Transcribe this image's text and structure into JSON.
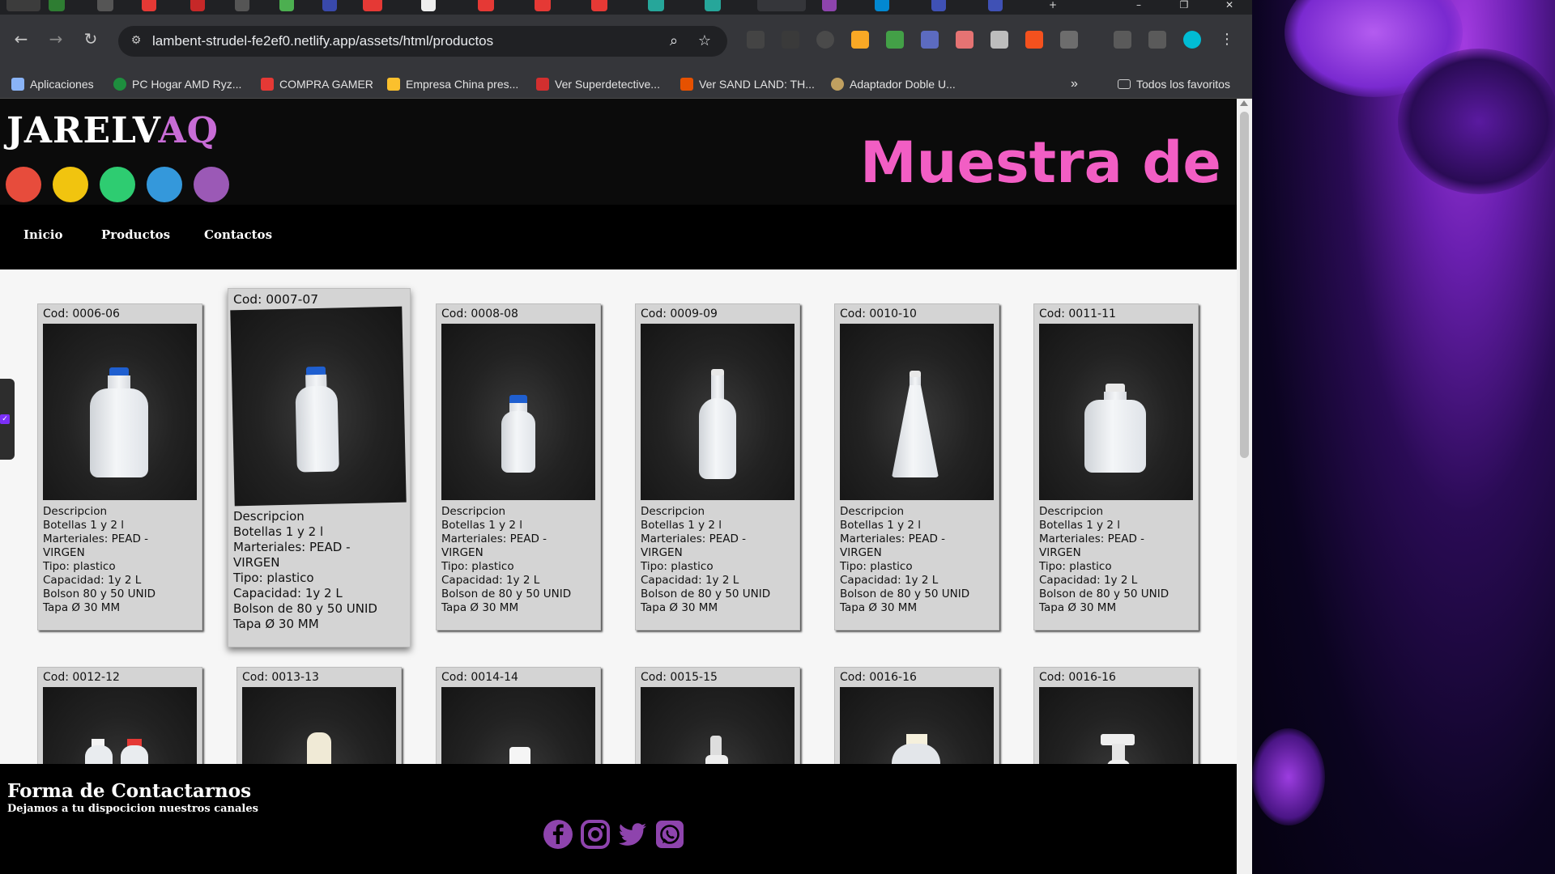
{
  "browser": {
    "url": "lambent-strudel-fe2ef0.netlify.app/assets/html/productos",
    "bookmarks": [
      {
        "label": "Aplicaciones",
        "color": "#8ab4f8"
      },
      {
        "label": "PC Hogar AMD Ryz...",
        "color": "#1e8e3e"
      },
      {
        "label": "COMPRA GAMER",
        "color": "#e53935"
      },
      {
        "label": "Empresa China pres...",
        "color": "#fbc02d"
      },
      {
        "label": "Ver Superdetective...",
        "color": "#d32f2f"
      },
      {
        "label": "Ver SAND LAND: TH...",
        "color": "#e65100"
      },
      {
        "label": "Adaptador Doble U...",
        "color": "#c0a060"
      }
    ],
    "all_bookmarks": "Todos los favoritos"
  },
  "site": {
    "logo_part1": "JARELV",
    "logo_part2": "AQ",
    "title": "Muestra de Productos",
    "dot_colors": [
      "#e74c3c",
      "#f1c40f",
      "#2ecc71",
      "#3498db",
      "#9b59b6"
    ],
    "nav": [
      "Inicio",
      "Productos",
      "Contactos"
    ]
  },
  "products": [
    {
      "code": "Cod: 0006-06",
      "desc": [
        "Descripcion",
        "Botellas 1 y 2 l",
        "Marteriales: PEAD -",
        "VIRGEN",
        "Tipo: plastico",
        "Capacidad: 1y 2 L",
        "Bolson 80 y 50 UNID",
        "Tapa Ø 30 MM"
      ],
      "cap_color": "#1f5fd0"
    },
    {
      "code": "Cod: 0007-07",
      "desc": [
        "Descripcion",
        "Botellas 1 y 2 l",
        "Marteriales: PEAD -",
        "VIRGEN",
        "Tipo: plastico",
        "Capacidad: 1y 2 L",
        "Bolson de 80 y 50 UNID",
        "Tapa Ø 30 MM"
      ],
      "cap_color": "#1f5fd0"
    },
    {
      "code": "Cod: 0008-08",
      "desc": [
        "Descripcion",
        "Botellas 1 y 2 l",
        "Marteriales: PEAD -",
        "VIRGEN",
        "Tipo: plastico",
        "Capacidad: 1y 2 L",
        "Bolson de 80 y 50 UNID",
        "Tapa Ø 30 MM"
      ],
      "cap_color": "#1f5fd0"
    },
    {
      "code": "Cod: 0009-09",
      "desc": [
        "Descripcion",
        "Botellas 1 y 2 l",
        "Marteriales: PEAD -",
        "VIRGEN",
        "Tipo: plastico",
        "Capacidad: 1y 2 L",
        "Bolson de 80 y 50 UNID",
        "Tapa Ø 30 MM"
      ],
      "cap_color": "#e8e8e8"
    },
    {
      "code": "Cod: 0010-10",
      "desc": [
        "Descripcion",
        "Botellas 1 y 2 l",
        "Marteriales: PEAD -",
        "VIRGEN",
        "Tipo: plastico",
        "Capacidad: 1y 2 L",
        "Bolson de 80 y 50 UNID",
        "Tapa Ø 30 MM"
      ],
      "cap_color": "#e8e8e8"
    },
    {
      "code": "Cod: 0011-11",
      "desc": [
        "Descripcion",
        "Botellas 1 y 2 l",
        "Marteriales: PEAD -",
        "VIRGEN",
        "Tipo: plastico",
        "Capacidad: 1y 2 L",
        "Bolson de 80 y 50 UNID",
        "Tapa Ø 30 MM"
      ],
      "cap_color": "#e8e8e8"
    }
  ],
  "products_row2": [
    {
      "code": "Cod: 0012-12",
      "cap_color": "#e53935"
    },
    {
      "code": "Cod: 0013-13",
      "cap_color": "#f0ead6"
    },
    {
      "code": "Cod: 0014-14",
      "cap_color": "#f5f5f5"
    },
    {
      "code": "Cod: 0015-15",
      "cap_color": "#dddddd"
    },
    {
      "code": "Cod: 0016-16",
      "cap_color": "#f5f0dc"
    },
    {
      "code": "Cod: 0016-16",
      "cap_color": "#eeeeee"
    }
  ],
  "footer": {
    "title": "Forma de Contactarnos",
    "subtitle": "Dejamos a tu dispocicion nuestros canales",
    "social_icons": [
      "facebook-icon",
      "instagram-icon",
      "twitter-icon",
      "whatsapp-icon"
    ],
    "social_color": "#8e44ad"
  }
}
